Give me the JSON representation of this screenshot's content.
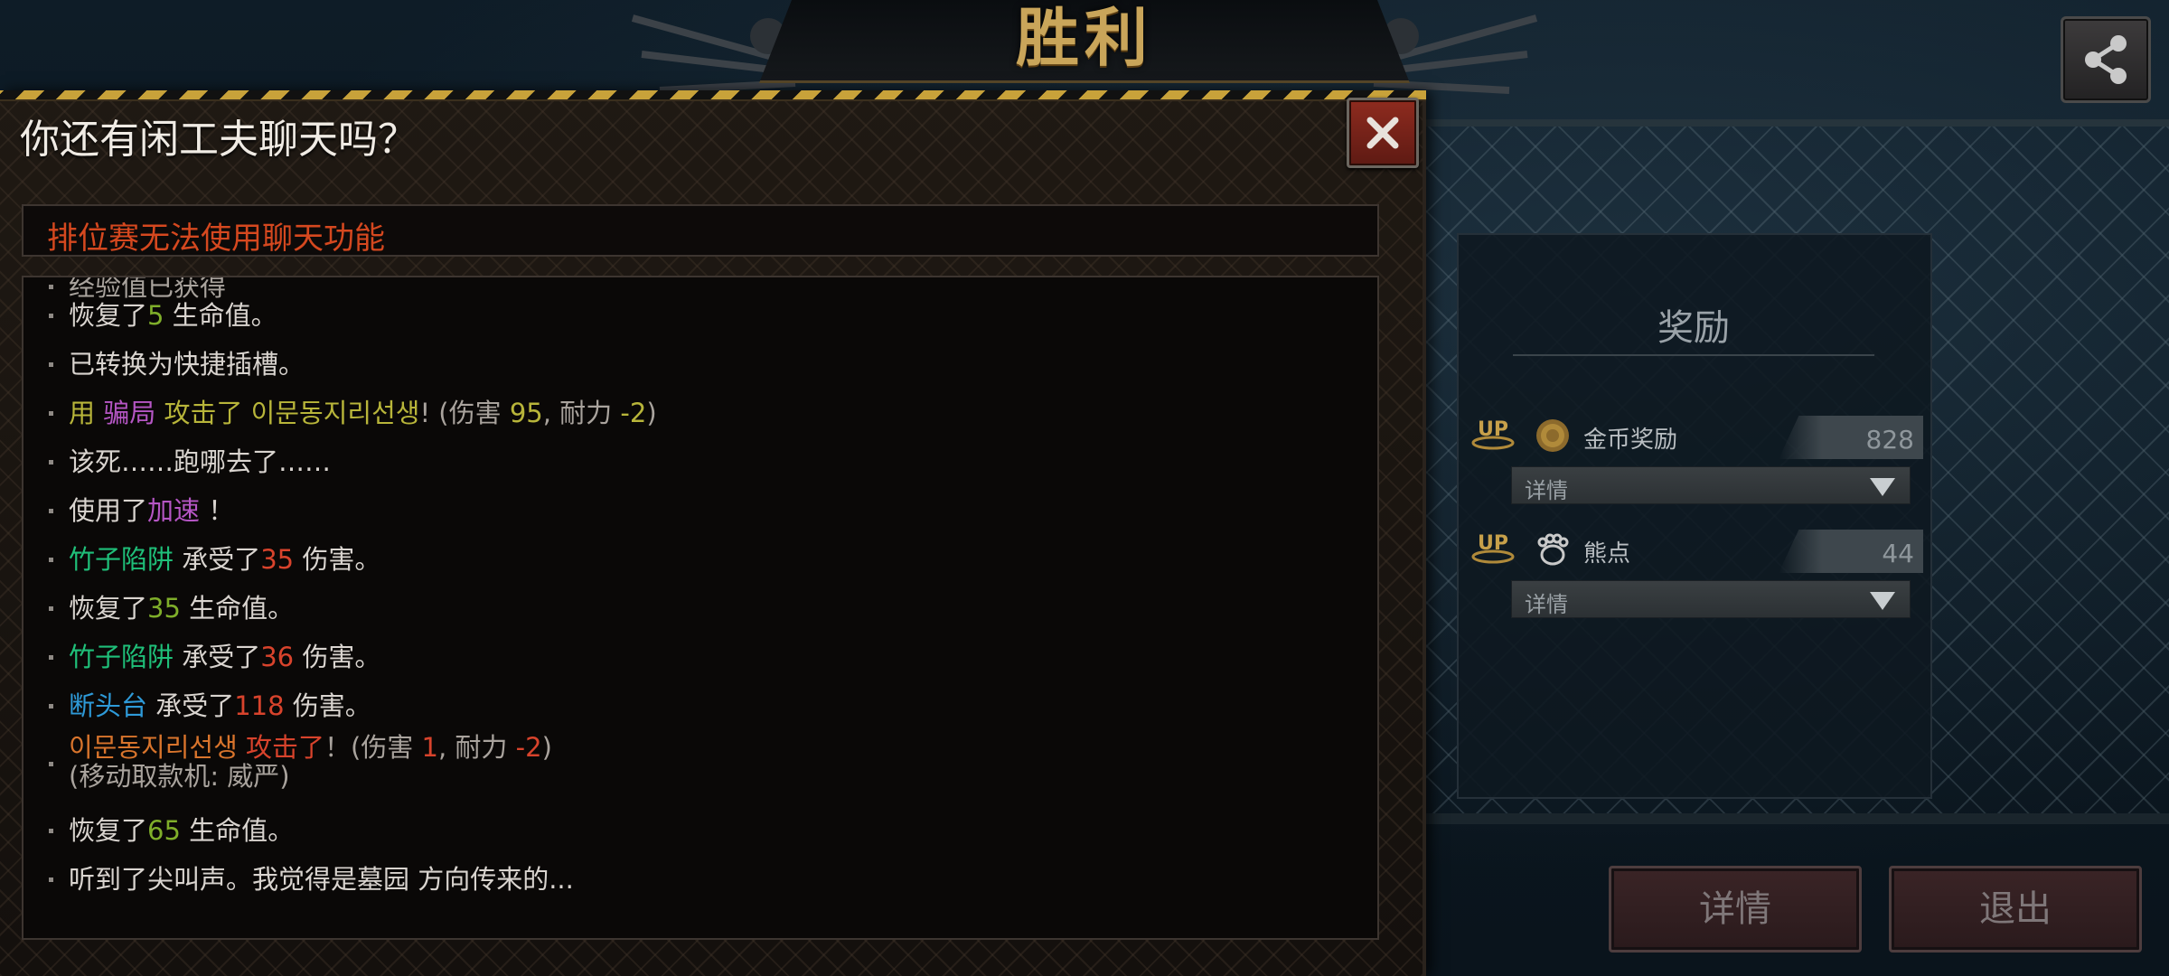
{
  "header": {
    "victory_title": "胜利",
    "share_icon": "share-icon"
  },
  "rewards": {
    "title": "奖励",
    "items": [
      {
        "badge": "UP",
        "icon": "gold-coin-icon",
        "label": "金币奖励",
        "value": "828",
        "details_label": "详情"
      },
      {
        "badge": "UP",
        "icon": "bear-paw-icon",
        "label": "熊点",
        "value": "44",
        "details_label": "详情"
      }
    ]
  },
  "actions": {
    "details_label": "详情",
    "exit_label": "退出"
  },
  "chat_dialog": {
    "title": "你还有闲工夫聊天吗？",
    "close_icon": "close-icon",
    "notice": "排位赛无法使用聊天功能",
    "log": {
      "l0": "经验值已获得",
      "l1_a": "恢复了",
      "l1_b": "5",
      "l1_c": " 生命值。",
      "l2": "已转换为快捷插槽。",
      "l3_a": " 用 ",
      "l3_b": "骗局",
      "l3_c": " 攻击了  ",
      "l3_d": "이문동지리선생",
      "l3_e": "! (伤害 ",
      "l3_f": "95",
      "l3_g": ",  耐力  ",
      "l3_h": "-2",
      "l3_i": ")",
      "l4": "该死……跑哪去了……",
      "l5_a": "使用了",
      "l5_b": "加速",
      "l5_c": " ！",
      "l6_a": "竹子陷阱",
      "l6_b": " 承受了",
      "l6_c": "35",
      "l6_d": " 伤害。",
      "l7_a": "恢复了",
      "l7_b": "35",
      "l7_c": " 生命值。",
      "l8_a": "竹子陷阱",
      "l8_b": " 承受了",
      "l8_c": "36",
      "l8_d": " 伤害。",
      "l9_a": "断头台",
      "l9_b": " 承受了",
      "l9_c": "118",
      "l9_d": " 伤害。",
      "l10_a": "이문동지리선생",
      "l10_b": "  攻击了",
      "l10_c": "！(伤害 ",
      "l10_d": "1",
      "l10_e": ",  耐力  ",
      "l10_f": "-2",
      "l10_g": ")",
      "l10_h": "(移动取款机: 威严)",
      "l11_a": "恢复了",
      "l11_b": "65",
      "l11_c": " 生命值。",
      "l12": "听到了尖叫声。我觉得是墓园 方向传来的..."
    }
  },
  "colors": {
    "victory_gold": "#c9a55a",
    "notice_red": "#d5481f",
    "heal_green": "#7fae2a",
    "damage_red": "#d8432c",
    "skill_purple": "#b556c4",
    "trap_teal": "#1fbf79",
    "trap_blue": "#2e9ad8",
    "hazard_yellow": "#c8a23a"
  }
}
